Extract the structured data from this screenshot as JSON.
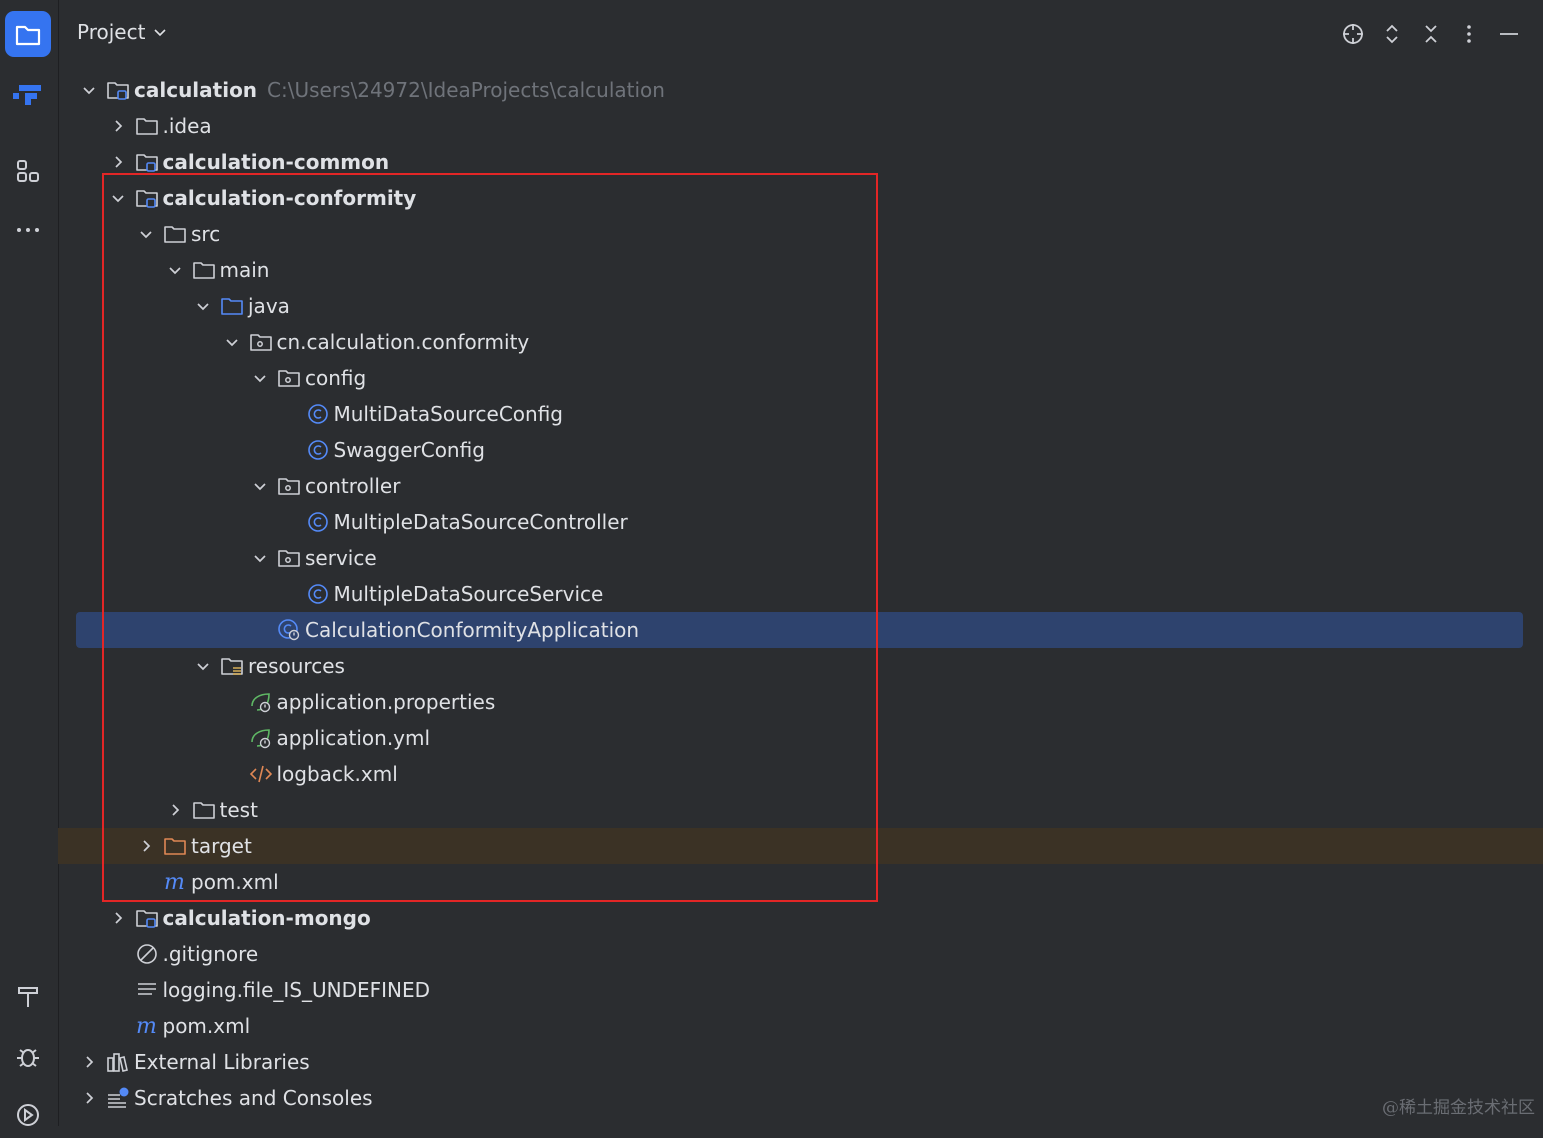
{
  "toolstrip": {
    "items": [
      {
        "name": "project-tool-icon",
        "active": true
      },
      {
        "name": "structure-tool-icon",
        "active": false
      },
      {
        "name": "modules-tool-icon",
        "active": false
      },
      {
        "name": "more-tools-icon",
        "active": false
      },
      {
        "name": "build-tool-icon",
        "active": false
      },
      {
        "name": "debug-tool-icon",
        "active": false
      },
      {
        "name": "services-tool-icon",
        "active": false
      }
    ]
  },
  "header": {
    "title": "Project",
    "actions": [
      "locate-icon",
      "expand-collapse-icon",
      "collapse-all-icon",
      "options-icon",
      "minimize-icon"
    ]
  },
  "tree": [
    {
      "depth": 0,
      "expanded": true,
      "icon": "module",
      "label": "calculation",
      "bold": true,
      "path": "C:\\Users\\24972\\IdeaProjects\\calculation"
    },
    {
      "depth": 1,
      "expanded": false,
      "icon": "folder",
      "label": ".idea"
    },
    {
      "depth": 1,
      "expanded": false,
      "icon": "module",
      "label": "calculation-common",
      "bold": true
    },
    {
      "depth": 1,
      "expanded": true,
      "icon": "module",
      "label": "calculation-conformity",
      "bold": true
    },
    {
      "depth": 2,
      "expanded": true,
      "icon": "folder",
      "label": "src"
    },
    {
      "depth": 3,
      "expanded": true,
      "icon": "folder",
      "label": "main"
    },
    {
      "depth": 4,
      "expanded": true,
      "icon": "source-folder",
      "label": "java"
    },
    {
      "depth": 5,
      "expanded": true,
      "icon": "package",
      "label": "cn.calculation.conformity"
    },
    {
      "depth": 6,
      "expanded": true,
      "icon": "package",
      "label": "config"
    },
    {
      "depth": 7,
      "icon": "class",
      "label": "MultiDataSourceConfig"
    },
    {
      "depth": 7,
      "icon": "class",
      "label": "SwaggerConfig"
    },
    {
      "depth": 6,
      "expanded": true,
      "icon": "package",
      "label": "controller"
    },
    {
      "depth": 7,
      "icon": "class",
      "label": "MultipleDataSourceController"
    },
    {
      "depth": 6,
      "expanded": true,
      "icon": "package",
      "label": "service"
    },
    {
      "depth": 7,
      "icon": "class",
      "label": "MultipleDataSourceService"
    },
    {
      "depth": 6,
      "icon": "spring-class",
      "label": "CalculationConformityApplication",
      "selected": true
    },
    {
      "depth": 4,
      "expanded": true,
      "icon": "resources-folder",
      "label": "resources"
    },
    {
      "depth": 5,
      "icon": "spring-config",
      "label": "application.properties"
    },
    {
      "depth": 5,
      "icon": "spring-config",
      "label": "application.yml"
    },
    {
      "depth": 5,
      "icon": "xml",
      "label": "logback.xml"
    },
    {
      "depth": 3,
      "expanded": false,
      "icon": "folder",
      "label": "test"
    },
    {
      "depth": 2,
      "expanded": false,
      "icon": "excluded-folder",
      "label": "target",
      "excluded": true
    },
    {
      "depth": 2,
      "icon": "maven",
      "label": "pom.xml"
    },
    {
      "depth": 1,
      "expanded": false,
      "icon": "module",
      "label": "calculation-mongo",
      "bold": true
    },
    {
      "depth": 1,
      "icon": "ignore",
      "label": ".gitignore"
    },
    {
      "depth": 1,
      "icon": "text",
      "label": "logging.file_IS_UNDEFINED"
    },
    {
      "depth": 1,
      "icon": "maven",
      "label": "pom.xml"
    },
    {
      "depth": 0,
      "expanded": false,
      "icon": "libraries",
      "label": "External Libraries"
    },
    {
      "depth": 0,
      "expanded": false,
      "icon": "scratches",
      "label": "Scratches and Consoles"
    }
  ],
  "colors": {
    "background": "#2b2d30",
    "selection": "#2e436e",
    "excluded": "#3b3225",
    "accent": "#3574f0",
    "highlight_box": "#e32626"
  },
  "watermark": "@稀土掘金技术社区"
}
